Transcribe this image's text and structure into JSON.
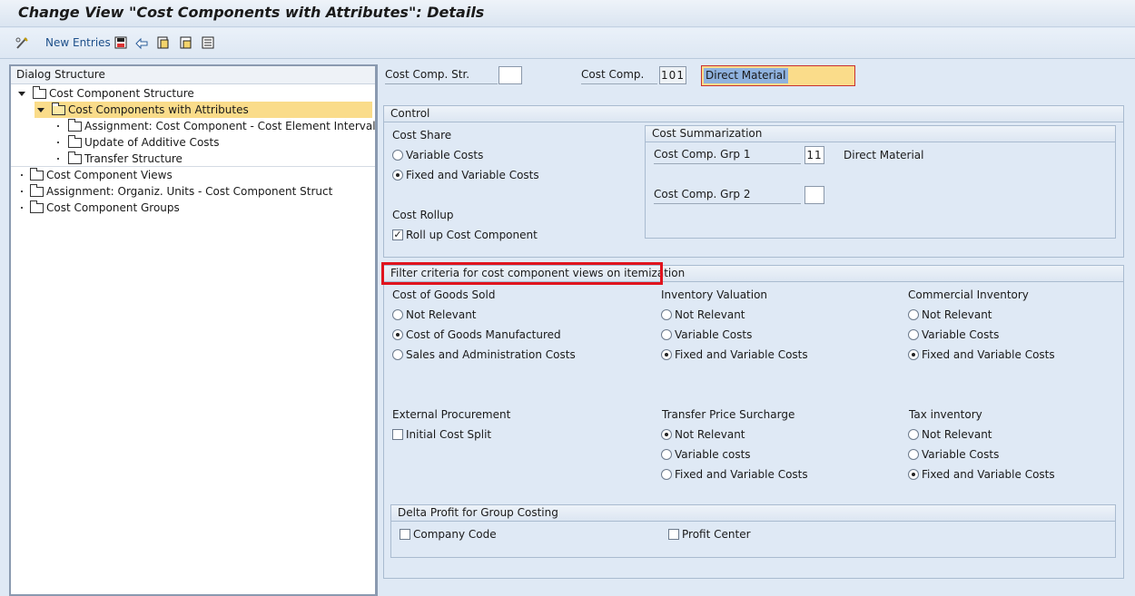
{
  "title": "Change View \"Cost Components with Attributes\": Details",
  "toolbar": {
    "new_entries_label": "New Entries",
    "icons": [
      "glasses-pen-icon",
      "save-icon",
      "undo-icon",
      "copy-icon",
      "delete-icon",
      "select-all-icon"
    ]
  },
  "dialog_structure": {
    "header": "Dialog Structure",
    "items": [
      {
        "label": "Cost Component Structure",
        "level": 0,
        "expanded": true
      },
      {
        "label": "Cost Components with Attributes",
        "level": 1,
        "expanded": true,
        "selected": true
      },
      {
        "label": "Assignment: Cost Component - Cost Element Interval",
        "level": 2
      },
      {
        "label": "Update of Additive Costs",
        "level": 2
      },
      {
        "label": "Transfer Structure",
        "level": 2
      },
      {
        "label": "Cost Component Views",
        "level": 0
      },
      {
        "label": "Assignment: Organiz. Units - Cost Component Struct",
        "level": 0
      },
      {
        "label": "Cost Component Groups",
        "level": 0
      }
    ]
  },
  "header_fields": {
    "cost_comp_str_label": "Cost Comp. Str.",
    "cost_comp_str_value": "",
    "cost_comp_label": "Cost Comp.",
    "cost_comp_value": "101",
    "cost_comp_desc": "Direct Material"
  },
  "control": {
    "title": "Control",
    "cost_share_label": "Cost Share",
    "cost_share_options": [
      "Variable Costs",
      "Fixed and Variable Costs"
    ],
    "cost_share_selected": 1,
    "cost_rollup_label": "Cost Rollup",
    "roll_up_label": "Roll up Cost Component",
    "roll_up_checked": true,
    "summarization": {
      "title": "Cost Summarization",
      "grp1_label": "Cost Comp. Grp 1",
      "grp1_value": "11",
      "grp1_desc": "Direct Material",
      "grp2_label": "Cost Comp. Grp 2",
      "grp2_value": ""
    }
  },
  "filter": {
    "title": "Filter criteria for cost component views on itemization",
    "cogs_label": "Cost of Goods Sold",
    "cogs_options": [
      "Not Relevant",
      "Cost of Goods Manufactured",
      "Sales and Administration Costs"
    ],
    "cogs_selected": 1,
    "inv_val_label": "Inventory Valuation",
    "inv_val_options": [
      "Not Relevant",
      "Variable Costs",
      "Fixed and Variable Costs"
    ],
    "inv_val_selected": 2,
    "comm_inv_label": "Commercial Inventory",
    "comm_inv_options": [
      "Not Relevant",
      "Variable Costs",
      "Fixed and Variable Costs"
    ],
    "comm_inv_selected": 2,
    "ext_proc_label": "External Procurement",
    "initial_split_label": "Initial Cost Split",
    "initial_split_checked": false,
    "transfer_label": "Transfer Price Surcharge",
    "transfer_options": [
      "Not Relevant",
      "Variable costs",
      "Fixed and Variable Costs"
    ],
    "transfer_selected": 0,
    "tax_label": "Tax inventory",
    "tax_options": [
      "Not Relevant",
      "Variable Costs",
      "Fixed and Variable Costs"
    ],
    "tax_selected": 2,
    "delta": {
      "title": "Delta Profit for Group Costing",
      "company_code_label": "Company Code",
      "profit_center_label": "Profit Center"
    }
  },
  "colors": {
    "highlight": "#fadc8a",
    "annotation_red": "#e0141e",
    "link_blue": "#1d4f8a"
  }
}
